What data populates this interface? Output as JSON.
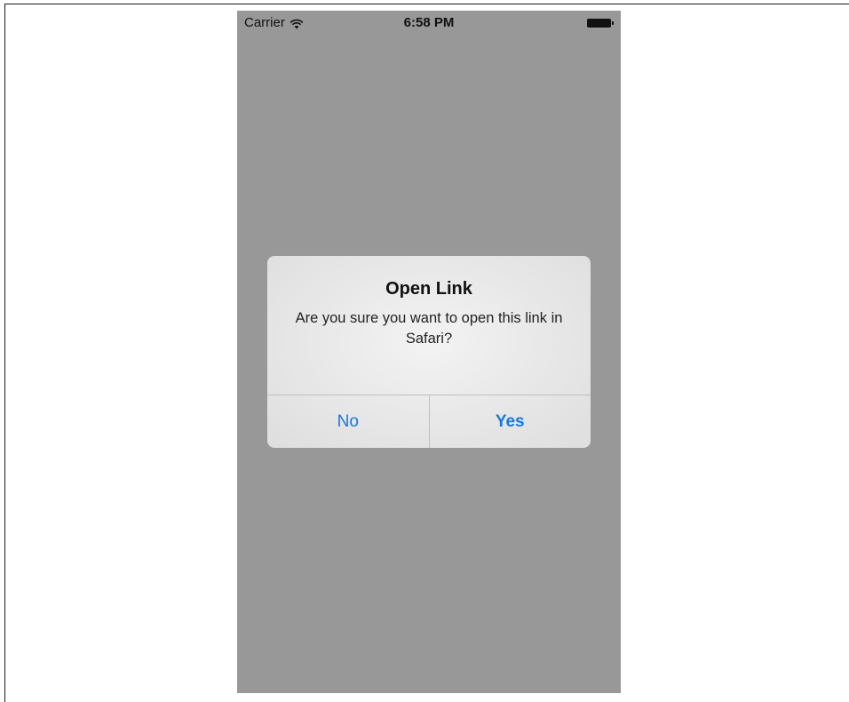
{
  "status_bar": {
    "carrier": "Carrier",
    "time": "6:58 PM",
    "wifi_icon": "wifi-icon",
    "battery_icon": "battery-icon"
  },
  "alert": {
    "title": "Open Link",
    "message": "Are you sure you want to open this link in Safari?",
    "no_label": "No",
    "yes_label": "Yes"
  },
  "colors": {
    "dim_overlay": "#989898",
    "button_tint": "#1478e6"
  }
}
